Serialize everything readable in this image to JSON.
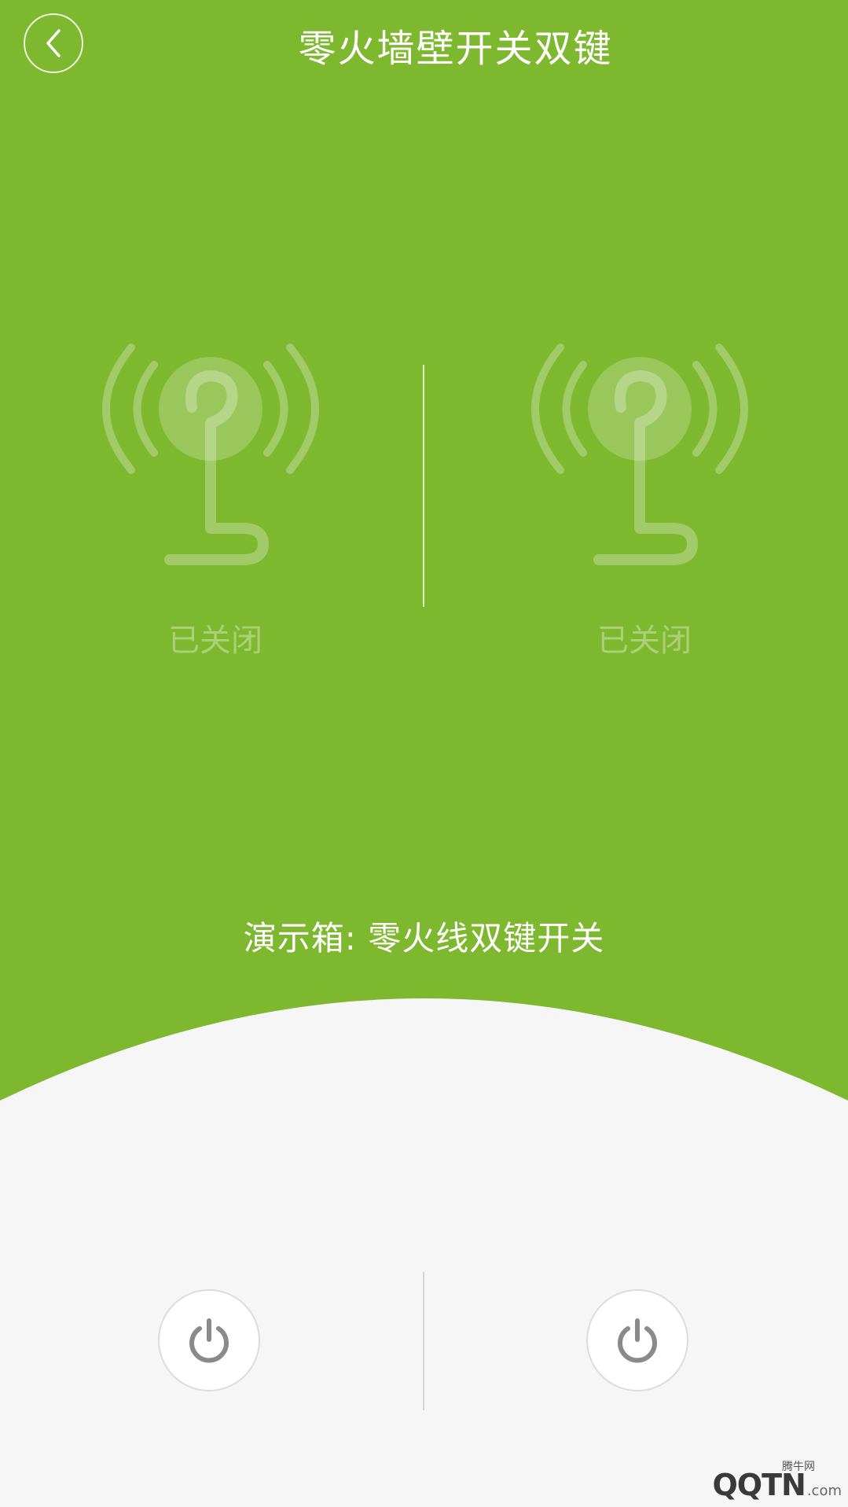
{
  "header": {
    "title": "零火墙壁开关双键"
  },
  "switches": [
    {
      "status": "已关闭"
    },
    {
      "status": "已关闭"
    }
  ],
  "caption": "演示箱: 零火线双键开关",
  "watermark": {
    "logo": "QQTN",
    "suffix": ".com",
    "small_text": "腾牛网"
  },
  "colors": {
    "primary_green": "#7db82f",
    "background": "#f6f6f6",
    "power_icon": "#8a8a8a"
  }
}
